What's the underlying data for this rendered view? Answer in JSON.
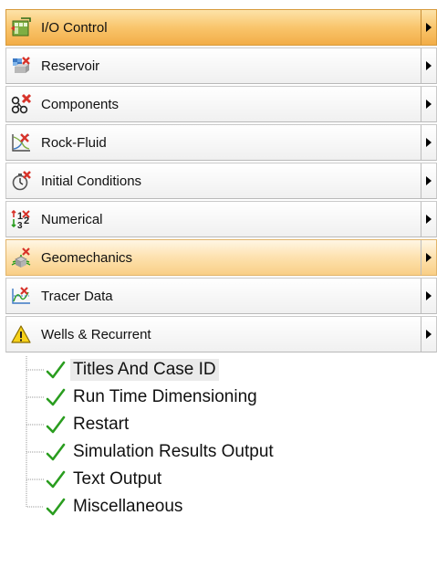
{
  "nav": {
    "items": [
      {
        "label": "I/O Control",
        "icon": "io-control-icon",
        "state": "active"
      },
      {
        "label": "Reservoir",
        "icon": "reservoir-icon",
        "state": "normal"
      },
      {
        "label": "Components",
        "icon": "components-icon",
        "state": "normal"
      },
      {
        "label": "Rock-Fluid",
        "icon": "rock-fluid-icon",
        "state": "normal"
      },
      {
        "label": "Initial Conditions",
        "icon": "initial-conditions-icon",
        "state": "normal"
      },
      {
        "label": "Numerical",
        "icon": "numerical-icon",
        "state": "normal"
      },
      {
        "label": "Geomechanics",
        "icon": "geomechanics-icon",
        "state": "hover"
      },
      {
        "label": "Tracer Data",
        "icon": "tracer-data-icon",
        "state": "normal"
      },
      {
        "label": "Wells & Recurrent",
        "icon": "warning-icon",
        "state": "normal"
      }
    ]
  },
  "tree": {
    "items": [
      {
        "label": "Titles And Case ID",
        "status": "checked"
      },
      {
        "label": "Run Time Dimensioning",
        "status": "checked"
      },
      {
        "label": "Restart",
        "status": "checked"
      },
      {
        "label": "Simulation Results Output",
        "status": "checked"
      },
      {
        "label": "Text Output",
        "status": "checked"
      },
      {
        "label": "Miscellaneous",
        "status": "checked"
      }
    ]
  },
  "colors": {
    "active_bg": "#f9c56c",
    "hover_bg": "#fde1ae",
    "check_green": "#2a9d1f",
    "warning_yellow": "#f7d21a"
  }
}
